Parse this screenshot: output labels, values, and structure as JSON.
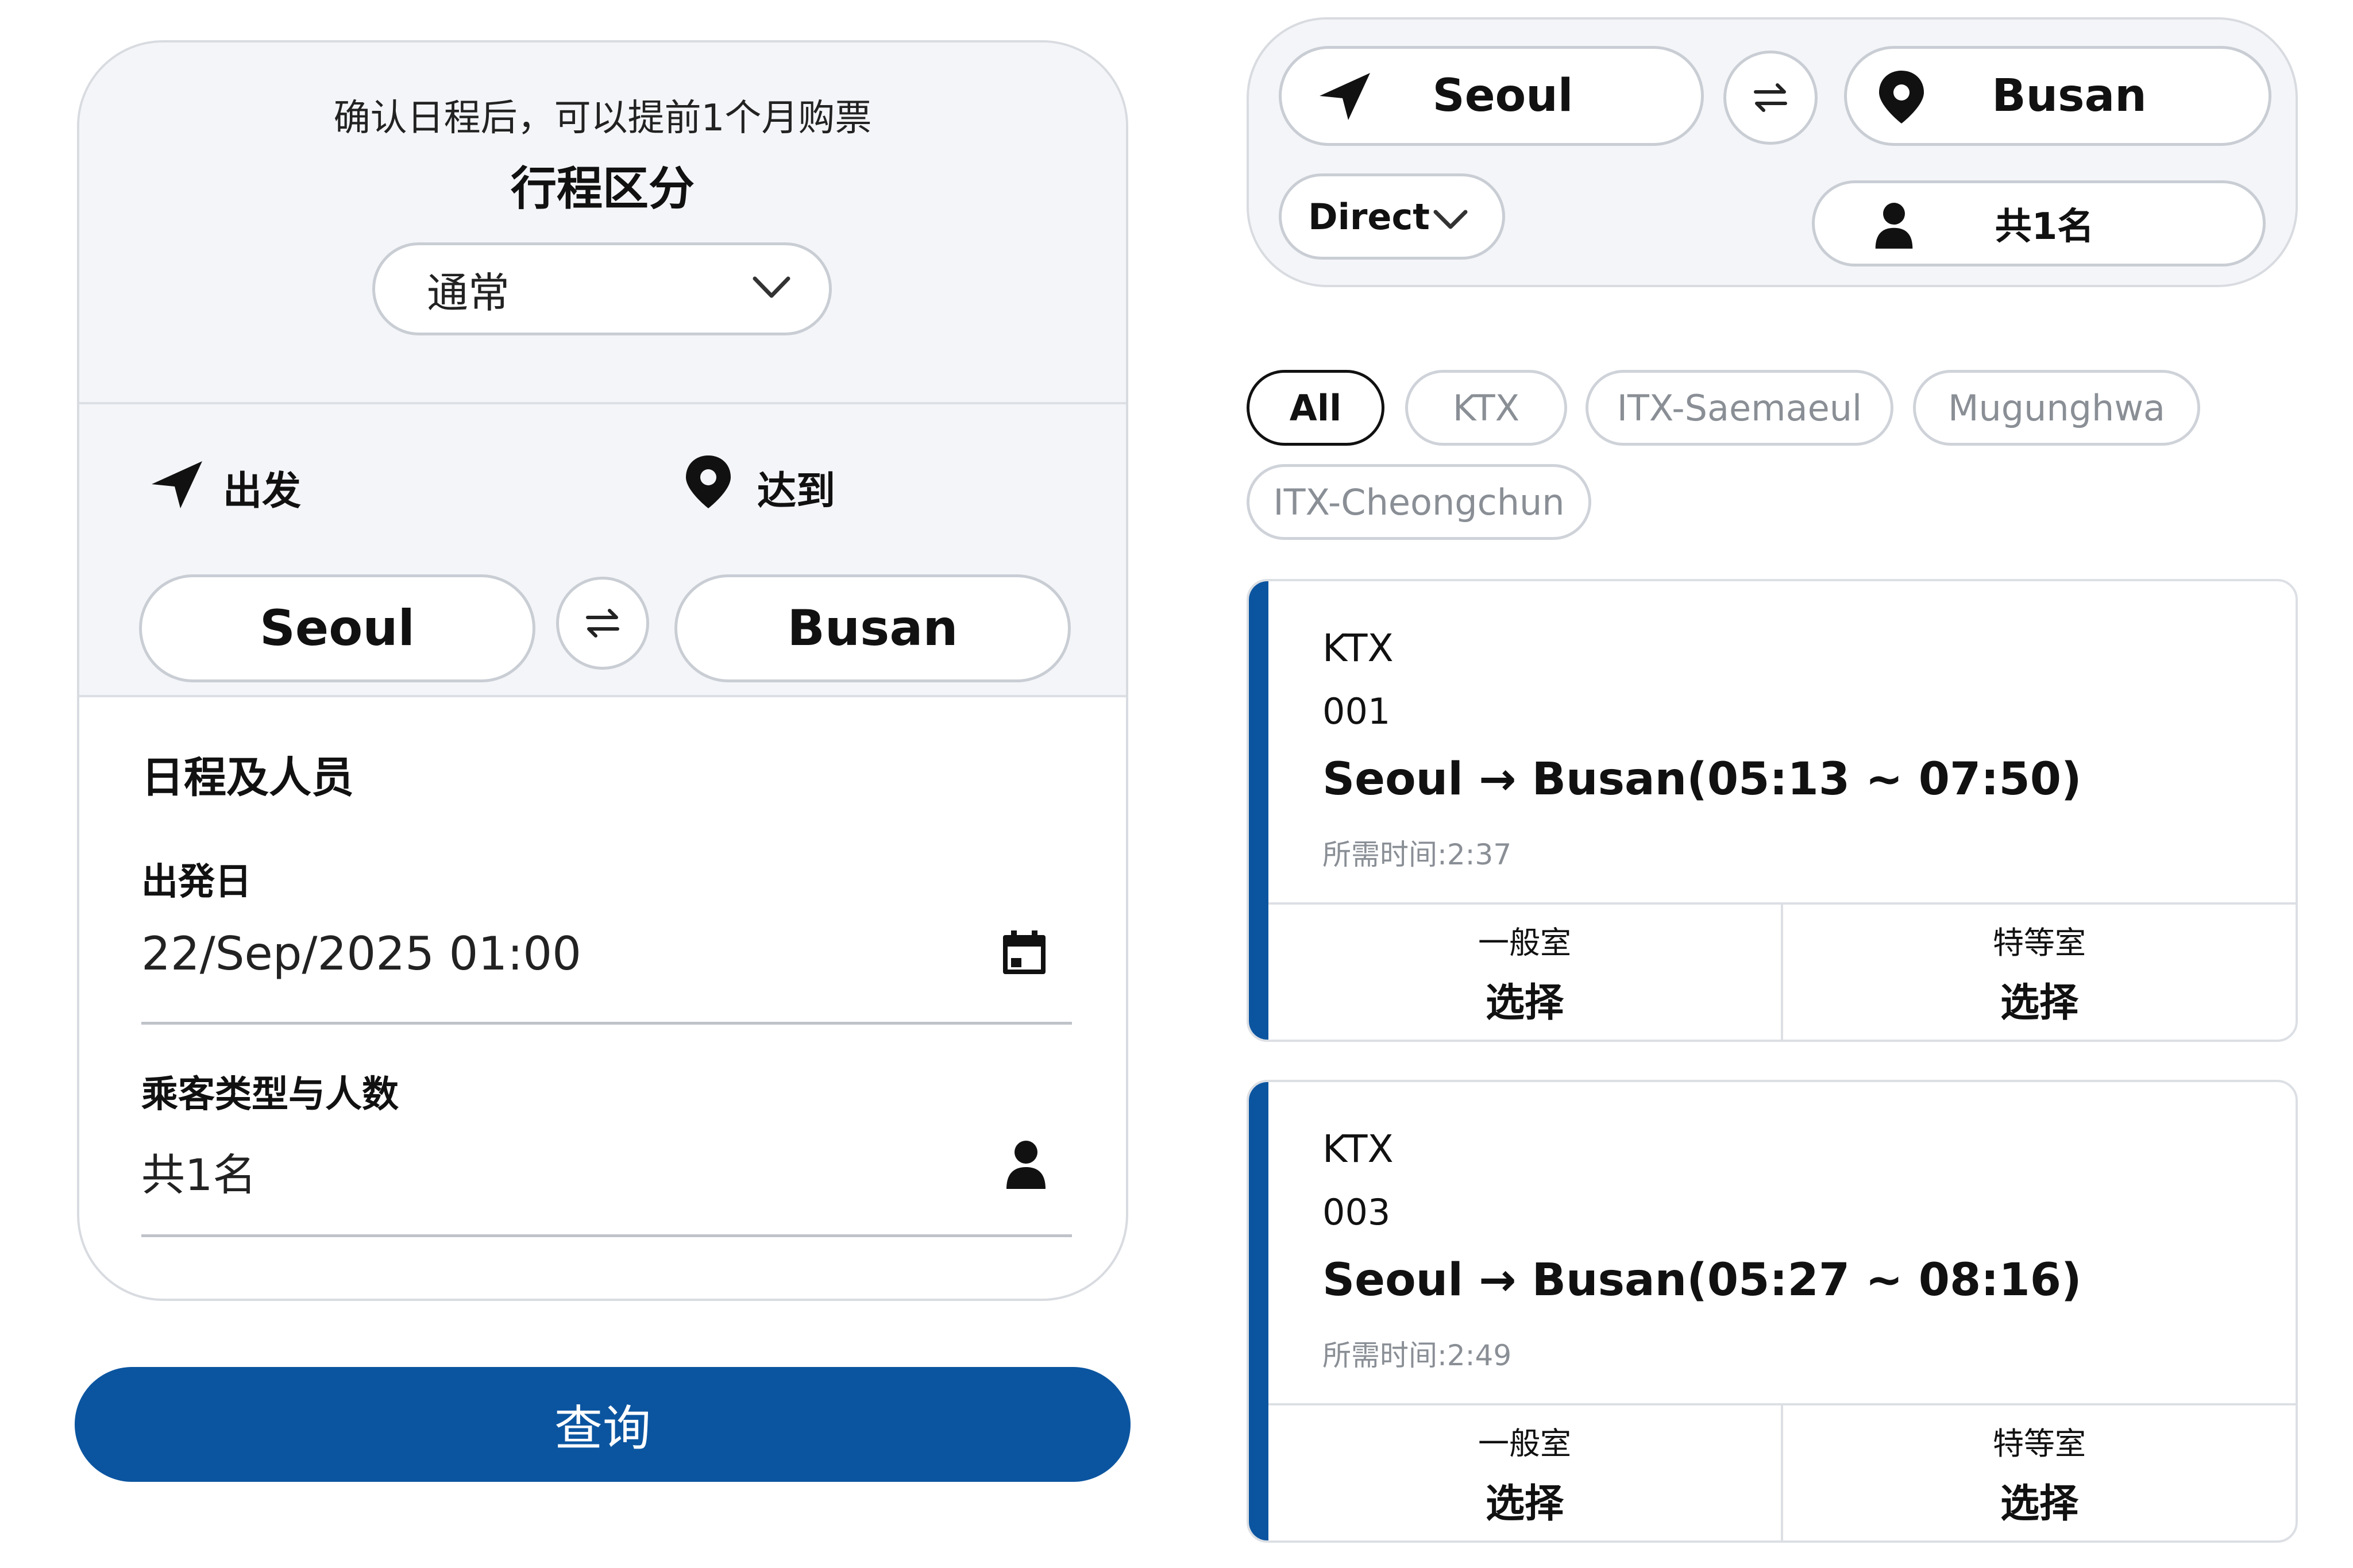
{
  "booking": {
    "notice": "确认日程后，可以提前1个月购票",
    "trip_type_title": "行程区分",
    "trip_type_value": "通常",
    "depart_label": "出发",
    "arrive_label": "达到",
    "origin": "Seoul",
    "destination": "Busan",
    "schedule_title": "日程及人员",
    "date_label": "出発日",
    "date_value": "22/Sep/2025 01:00",
    "passenger_label": "乘客类型与人数",
    "passenger_value": "共1名",
    "search_button": "查询"
  },
  "summary": {
    "origin": "Seoul",
    "destination": "Busan",
    "route_type": "Direct",
    "passengers": "共1名"
  },
  "filters": [
    "All",
    "KTX",
    "ITX-Saemaeul",
    "Mugunghwa",
    "ITX-Cheongchun"
  ],
  "trains": [
    {
      "type": "KTX",
      "number": "001",
      "route": "Seoul → Busan(05:13 ~ 07:50)",
      "duration": "所需时间:2:37",
      "standard_label": "一般室",
      "standard_action": "选择",
      "first_label": "特等室",
      "first_action": "选择"
    },
    {
      "type": "KTX",
      "number": "003",
      "route": "Seoul → Busan(05:27 ~ 08:16)",
      "duration": "所需时间:2:49",
      "standard_label": "一般室",
      "standard_action": "选择",
      "first_label": "特等室",
      "first_action": "选择"
    }
  ],
  "colors": {
    "primary": "#0b55a0",
    "panel_bg": "#f4f5f8",
    "border": "#c9cdd4",
    "muted_text": "#8a8f96"
  }
}
